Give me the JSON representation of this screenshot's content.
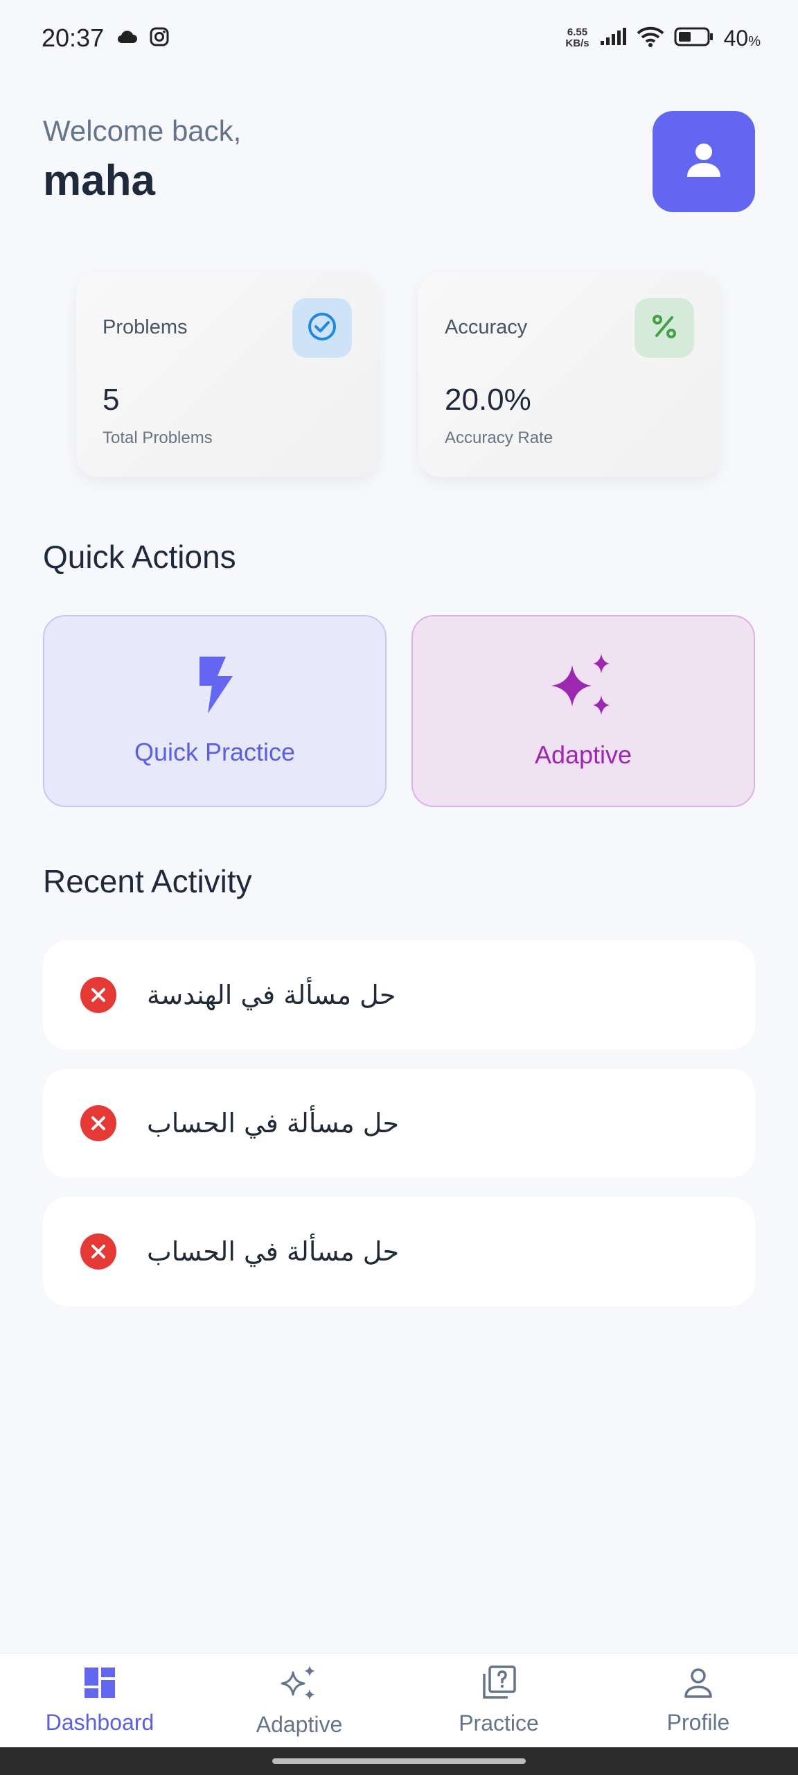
{
  "status_bar": {
    "time": "20:37",
    "net_speed_value": "6.55",
    "net_speed_unit": "KB/s",
    "battery_percent": "40",
    "battery_percent_sign": "%",
    "icons": [
      "cloud-icon",
      "instagram-icon",
      "signal-icon",
      "wifi-icon",
      "battery-icon"
    ]
  },
  "header": {
    "welcome": "Welcome back,",
    "username": "maha",
    "avatar_icon": "person-icon"
  },
  "stats": [
    {
      "title": "Problems",
      "value": "5",
      "subtitle": "Total Problems",
      "icon": "check-circle-icon",
      "icon_bg": "#cfe3f8",
      "icon_color": "#1e88e5"
    },
    {
      "title": "Accuracy",
      "value": "20.0%",
      "subtitle": "Accuracy Rate",
      "icon": "percent-icon",
      "icon_bg": "#d6ead9",
      "icon_color": "#43a047"
    }
  ],
  "quick_actions": {
    "title": "Quick Actions",
    "items": [
      {
        "label": "Quick Practice",
        "icon": "bolt-icon",
        "color": "#6366f1"
      },
      {
        "label": "Adaptive",
        "icon": "sparkle-icon",
        "color": "#9c27b0"
      }
    ]
  },
  "recent_activity": {
    "title": "Recent Activity",
    "items": [
      {
        "text": "حل مسألة في الهندسة",
        "status_icon": "error-circle-icon"
      },
      {
        "text": "حل مسألة في الحساب",
        "status_icon": "error-circle-icon"
      },
      {
        "text": "حل مسألة في الحساب",
        "status_icon": "error-circle-icon"
      }
    ]
  },
  "bottom_nav": {
    "items": [
      {
        "label": "Dashboard",
        "icon": "dashboard-icon",
        "active": true
      },
      {
        "label": "Adaptive",
        "icon": "sparkle-icon",
        "active": false
      },
      {
        "label": "Practice",
        "icon": "quiz-icon",
        "active": false
      },
      {
        "label": "Profile",
        "icon": "person-outline-icon",
        "active": false
      }
    ]
  },
  "colors": {
    "accent": "#6366f1",
    "adaptive_accent": "#9c27b0",
    "error": "#e53935",
    "background": "#f7f8fb"
  }
}
